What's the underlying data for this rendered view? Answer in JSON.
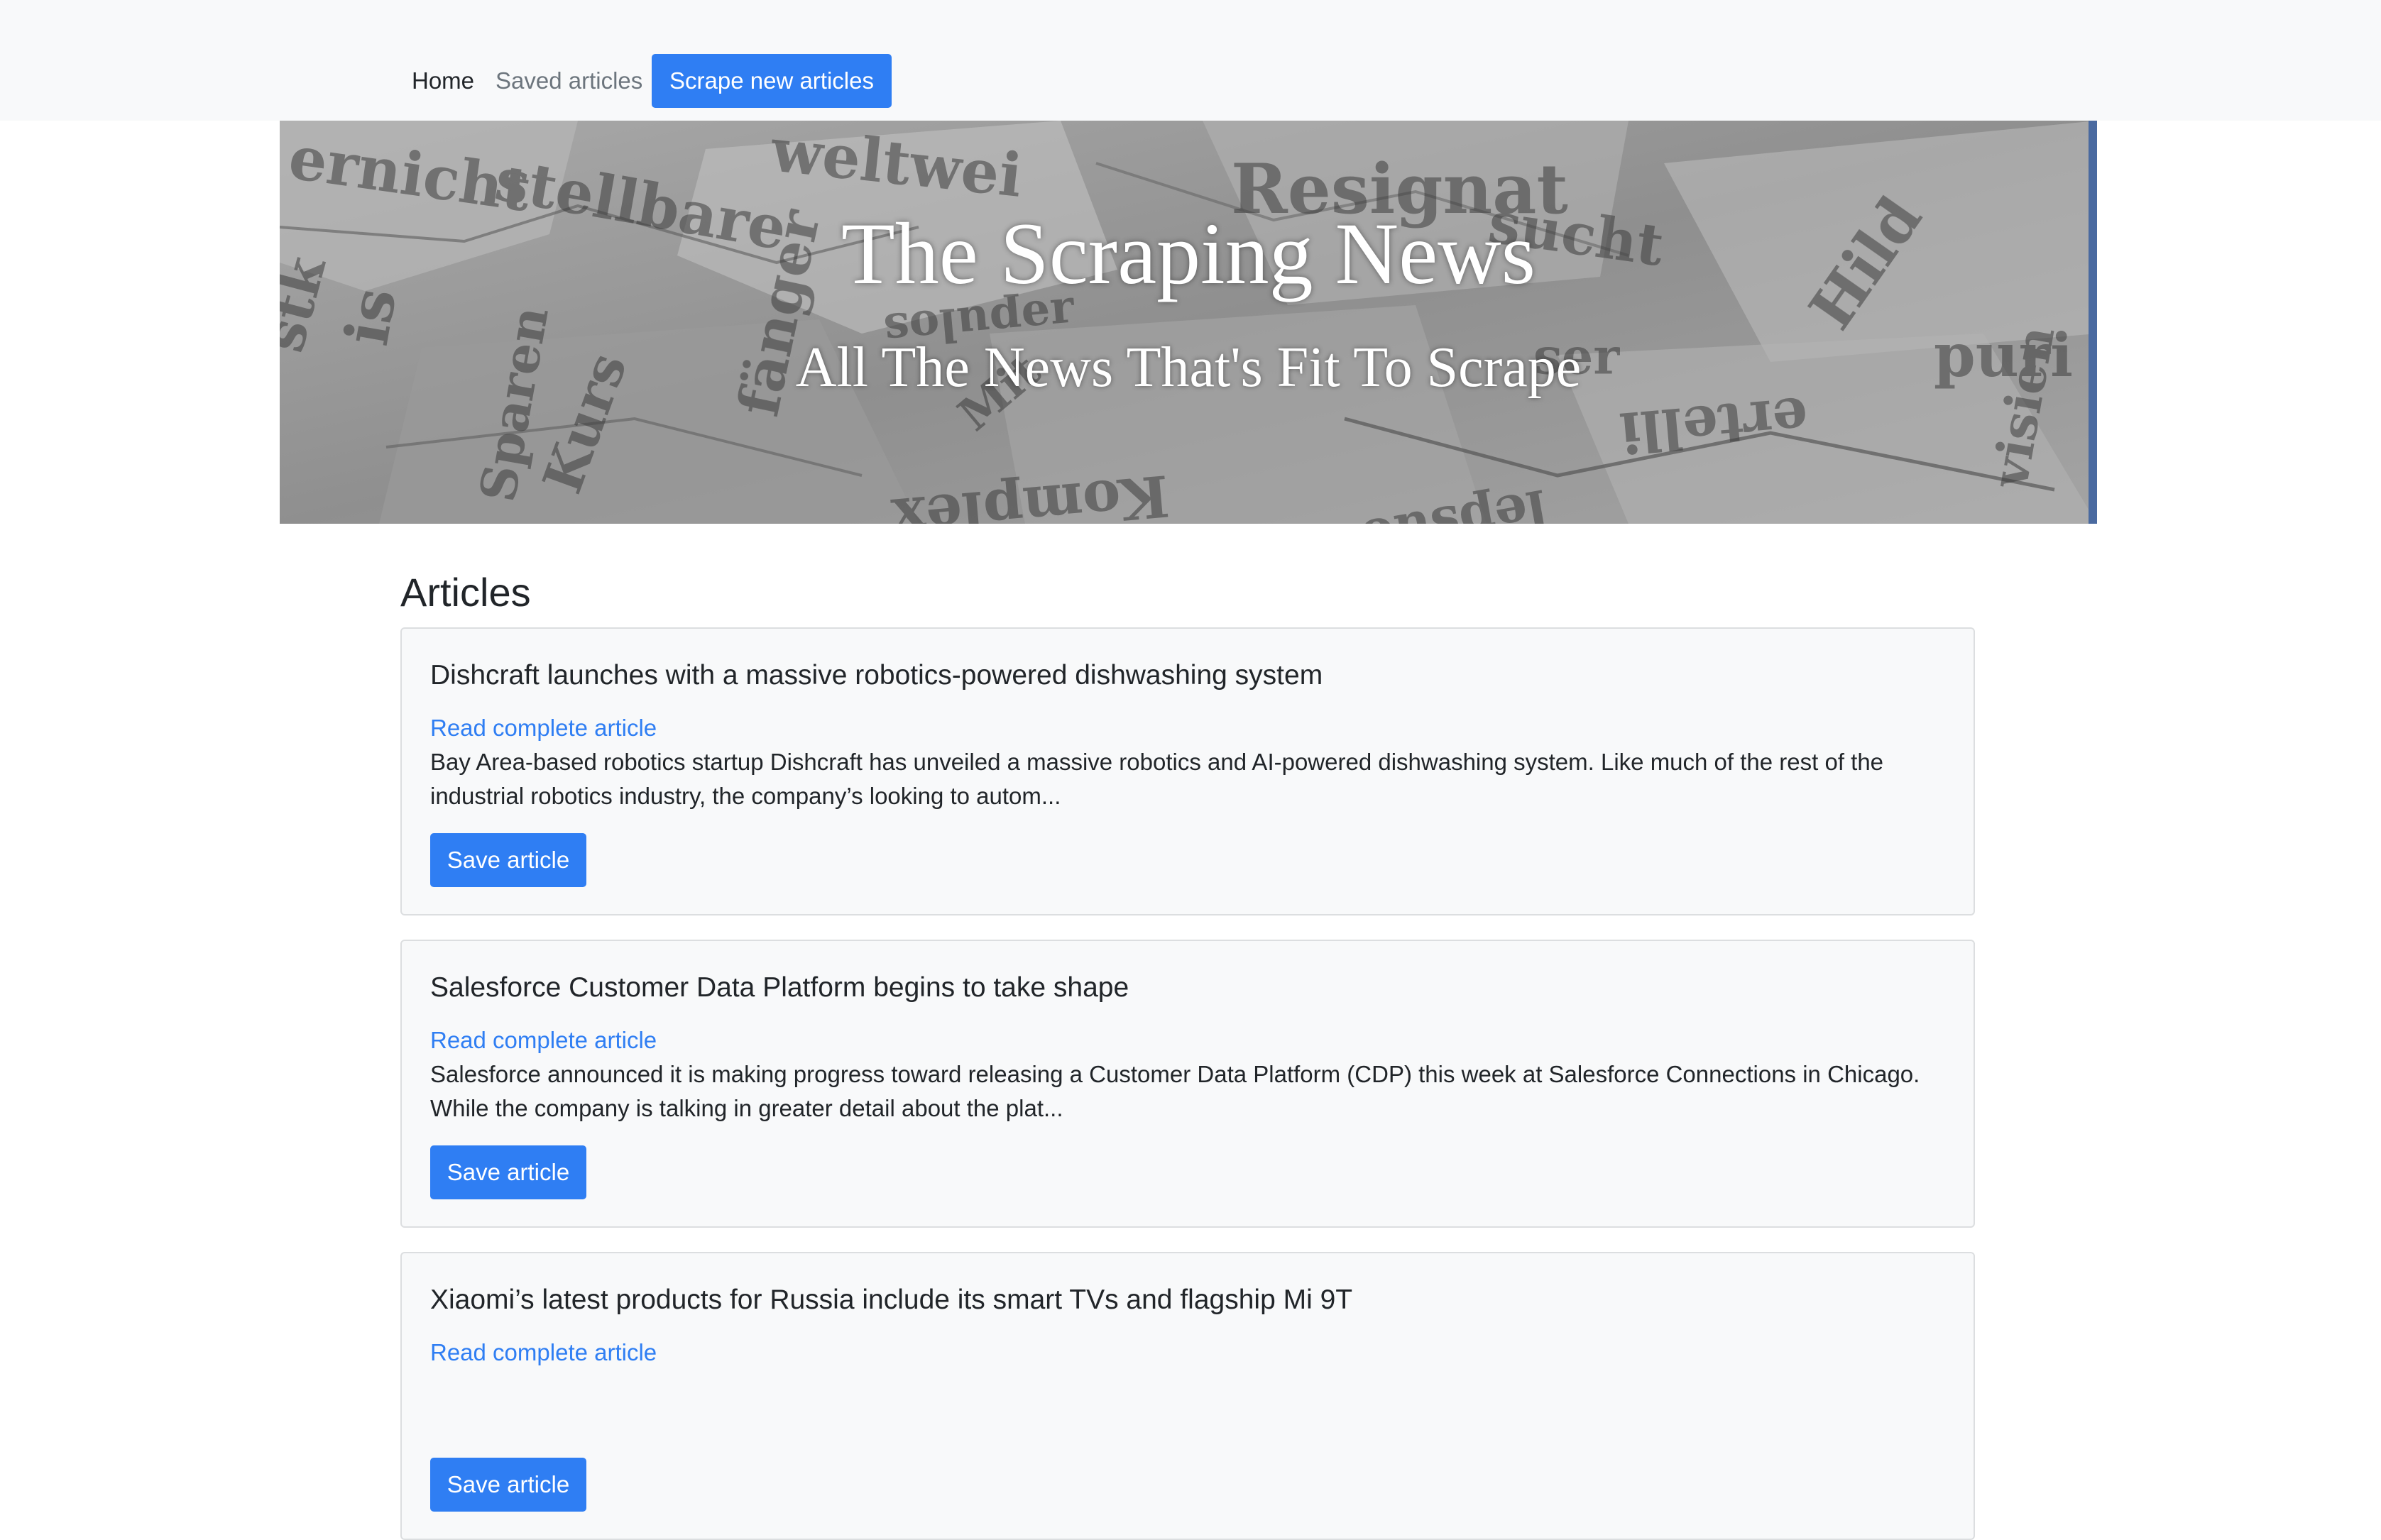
{
  "navbar": {
    "home_label": "Home",
    "saved_label": "Saved articles",
    "scrape_label": "Scrape new articles"
  },
  "hero": {
    "title": "The Scraping News",
    "subtitle": "All The News That's Fit To Scrape"
  },
  "articles_heading": "Articles",
  "articles": [
    {
      "title": "Dishcraft launches with a massive robotics-powered dishwashing system",
      "link_label": "Read complete article",
      "summary": "Bay Area-based robotics startup Dishcraft has unveiled a massive robotics and AI-powered dishwashing system. Like much of the rest of the industrial robotics industry, the company’s looking to autom...",
      "button_label": "Save article"
    },
    {
      "title": "Salesforce Customer Data Platform begins to take shape",
      "link_label": "Read complete article",
      "summary": "Salesforce announced it is making progress toward releasing a Customer Data Platform (CDP) this week at Salesforce Connections in Chicago. While the company is talking in greater detail about the plat...",
      "button_label": "Save article"
    },
    {
      "title": "Xiaomi’s latest products for Russia include its smart TVs and flagship Mi 9T",
      "link_label": "Read complete article",
      "summary": "",
      "button_label": "Save article"
    }
  ],
  "colors": {
    "accent": "#2f7ef3",
    "navbar_bg": "#f8f9fa",
    "card_bg": "#f8f9fa",
    "muted_text": "#6c757d",
    "body_text": "#212529"
  }
}
